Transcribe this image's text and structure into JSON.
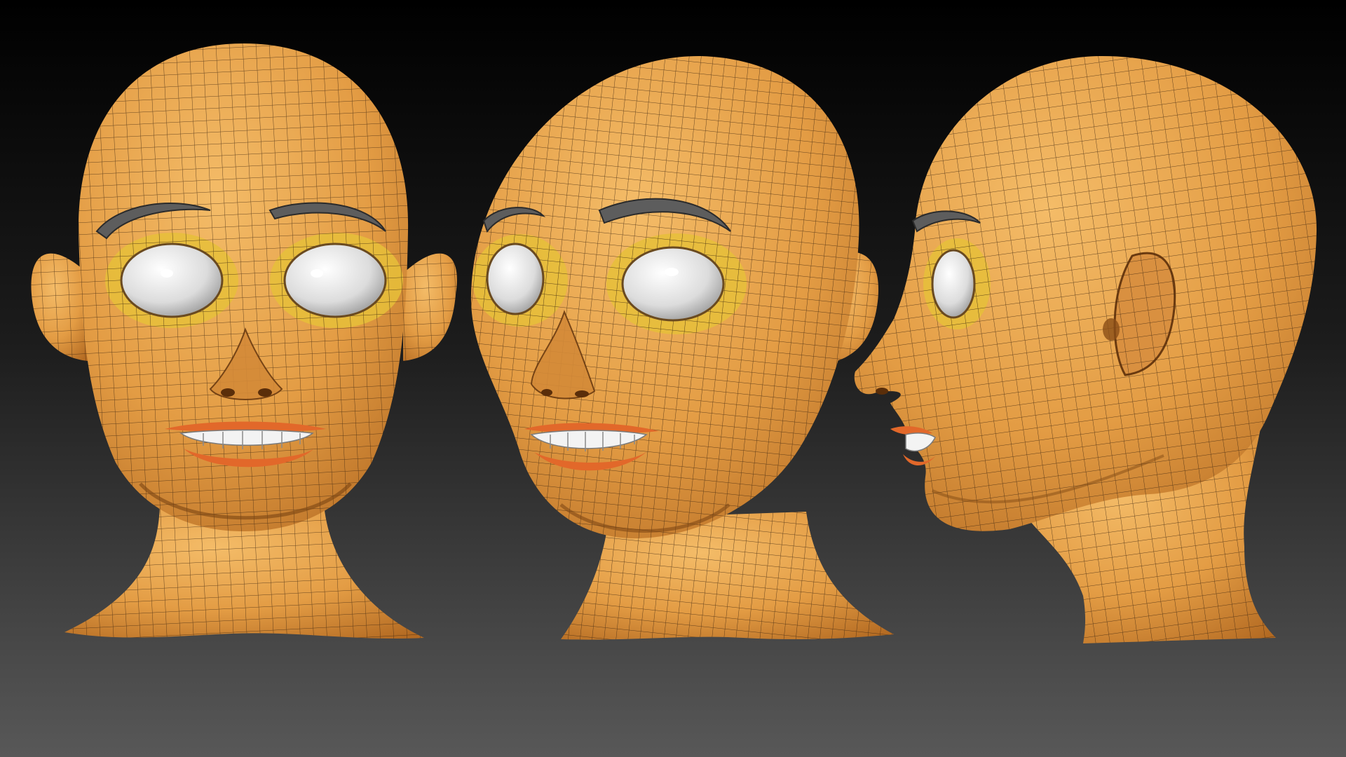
{
  "scene": {
    "views": [
      {
        "view": "front"
      },
      {
        "view": "three-quarter"
      },
      {
        "view": "profile"
      }
    ]
  },
  "colors": {
    "background_top": "#000000",
    "background_bottom": "#585858",
    "skin": "#e8a24a",
    "skin_light": "#f2b662",
    "skin_shadow": "#a8621c",
    "wire": "#3a2410",
    "eye_white": "#e2e2e2",
    "eye_socket": "#e6c03a",
    "brow": "#5d5d5d",
    "lip": "#e2682a",
    "teeth": "#f3f3f3"
  }
}
